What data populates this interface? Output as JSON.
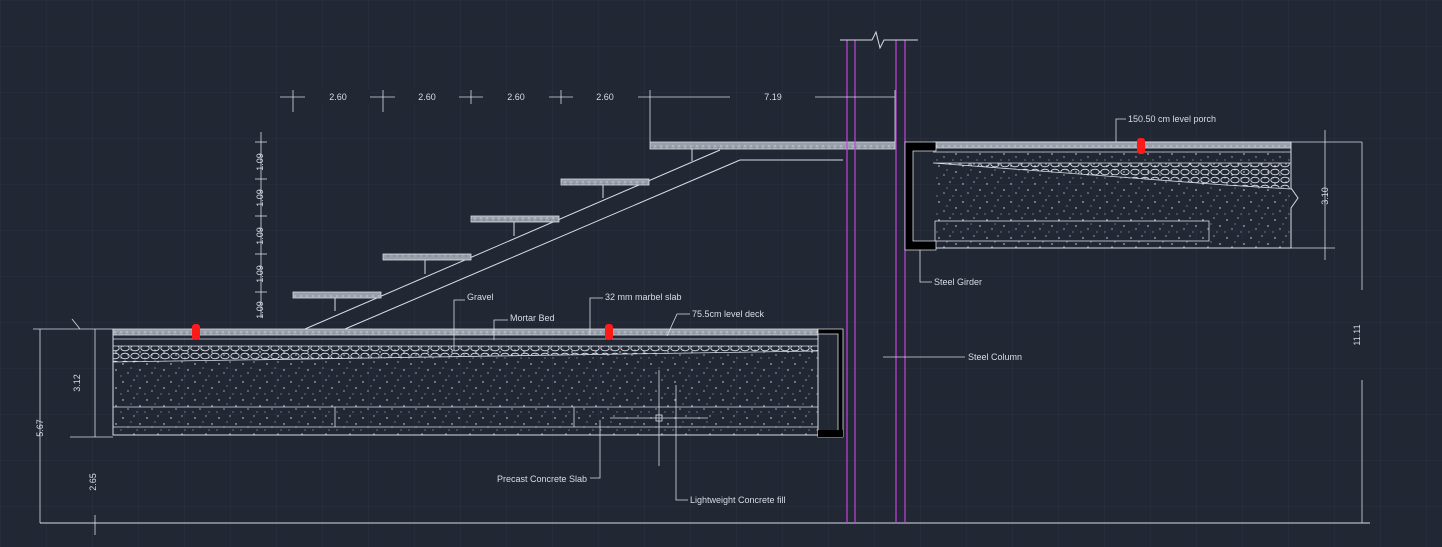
{
  "drawing": {
    "background": "#212733",
    "grid_color": "#2b3240",
    "line_color": "#d8dde6",
    "column_color": "#c542e0",
    "marker_color": "#ff1a1a",
    "horizontal_dims": [
      "2.60",
      "2.60",
      "2.60",
      "2.60",
      "7.19"
    ],
    "vertical_dims": [
      "1.09",
      "1.09",
      "1.09",
      "1.09",
      "1.09"
    ],
    "right_dims": {
      "porch_thickness": "3.10",
      "total_height": "11.11"
    },
    "left_dims": {
      "deck_thickness": "3.12",
      "overall": "5.67",
      "base": "2.65"
    },
    "labels": {
      "gravel": "Gravel",
      "marble": "32 mm marbel slab",
      "mortar": "Mortar Bed",
      "deck_level": "75.5cm level deck",
      "porch_level": "150.50 cm level porch",
      "girder": "Steel Girder",
      "column": "Steel Column",
      "precast": "Precast Concrete Slab",
      "lightweight": "Lightweight Concrete fill"
    }
  }
}
